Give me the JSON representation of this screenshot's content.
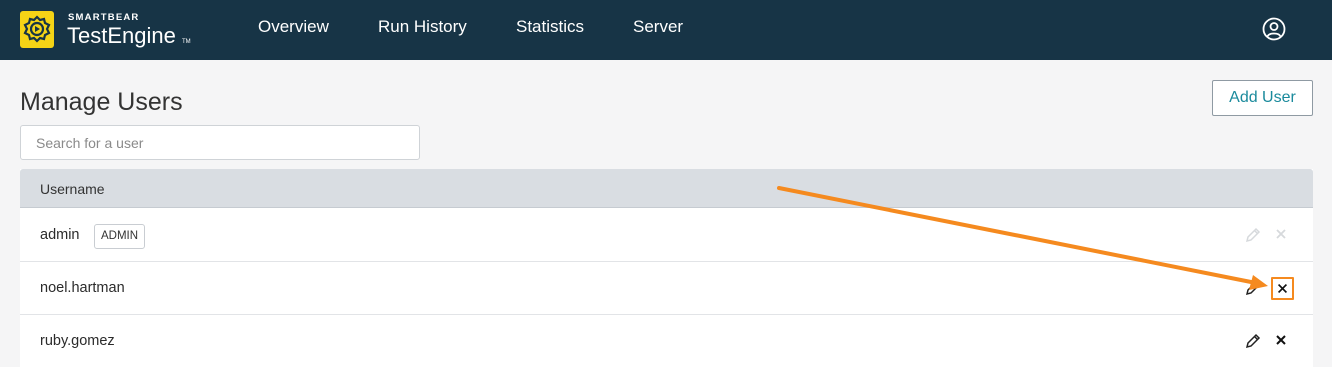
{
  "header": {
    "brand_company": "SMARTBEAR",
    "brand_product": "TestEngine",
    "brand_tm": "TM",
    "nav": [
      "Overview",
      "Run History",
      "Statistics",
      "Server"
    ],
    "user_icon": "user-circle-icon"
  },
  "page": {
    "title": "Manage Users",
    "add_user_label": "Add User",
    "search_placeholder": "Search for a user"
  },
  "table": {
    "column_username": "Username",
    "rows": [
      {
        "username": "admin",
        "badge": "ADMIN",
        "actions_enabled": false
      },
      {
        "username": "noel.hartman",
        "badge": "",
        "actions_enabled": true
      },
      {
        "username": "ruby.gomez",
        "badge": "",
        "actions_enabled": true
      }
    ]
  },
  "colors": {
    "topbar": "#173446",
    "logo": "#f5d416",
    "accent_link": "#1a8a9c",
    "annotation": "#f58a1f"
  },
  "icons": {
    "edit": "pencil-icon",
    "delete": "close-icon"
  }
}
